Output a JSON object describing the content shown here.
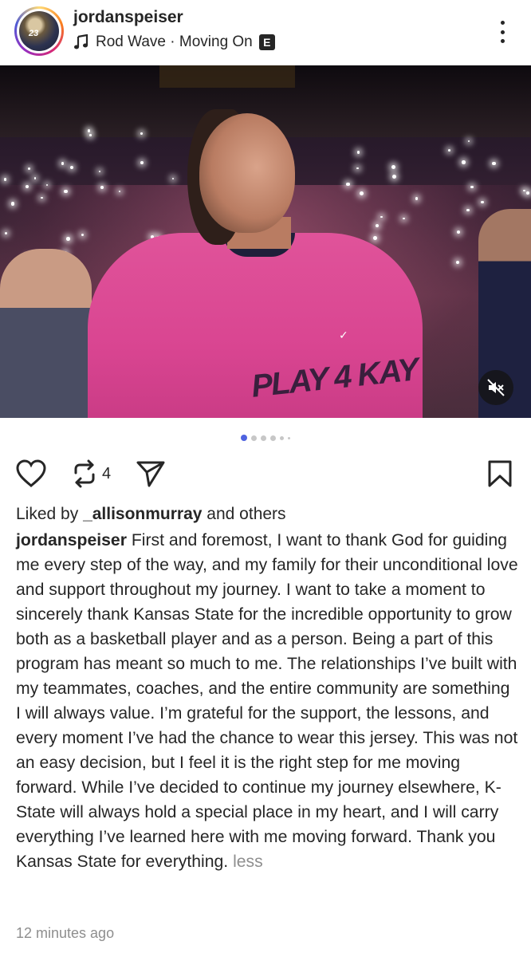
{
  "header": {
    "username": "jordanspeiser",
    "avatar_number": "23",
    "song": "Rod Wave · Moving On",
    "explicit_badge": "E"
  },
  "photo": {
    "shirt_print": "PLAY 4 KAY",
    "carousel_total": 6,
    "carousel_active": 1
  },
  "actions": {
    "repost_count": "4"
  },
  "likes": {
    "prefix": "Liked by ",
    "user": "_allisonmurray",
    "suffix": " and others"
  },
  "caption": {
    "username": "jordanspeiser",
    "text": "First and foremost, I want to thank God for guiding me every step of the way, and my family for their unconditional love and support throughout my journey. I want to take a moment to sincerely thank Kansas State for the incredible opportunity to grow both as a basketball player and as a person. Being a part of this program has meant so much to me. The relationships I’ve built with my teammates, coaches, and the entire community are something I will always value. I’m grateful for the support, the lessons, and every moment I’ve had the chance to wear this jersey. This was not an easy decision, but I feel it is the right step for me moving forward. While I’ve decided to continue my journey elsewhere, K-State will always hold a special place in my heart, and I will carry everything I’ve learned here with me moving forward. Thank you Kansas State for everything.",
    "less_label": "less"
  },
  "timestamp": "12 minutes ago",
  "colors": {
    "accent": "#4f63e0",
    "text": "#262626",
    "muted": "#8e8e8e",
    "shirt": "#e0539a"
  },
  "icons": [
    "music-note-icon",
    "more-options-icon",
    "mute-icon",
    "heart-icon",
    "repost-icon",
    "share-icon",
    "bookmark-icon"
  ]
}
